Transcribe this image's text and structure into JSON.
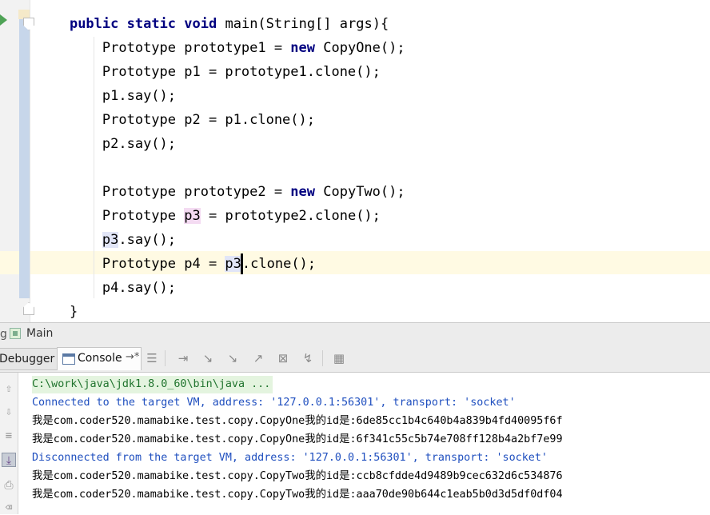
{
  "editor": {
    "lines": [
      {
        "indent": "    ",
        "tokens": [
          {
            "t": "public",
            "k": "kw"
          },
          {
            "t": " "
          },
          {
            "t": "static",
            "k": "kw"
          },
          {
            "t": " "
          },
          {
            "t": "void",
            "k": "kw"
          },
          {
            "t": " main(String[] args){"
          }
        ]
      },
      {
        "indent": "        ",
        "tokens": [
          {
            "t": "Prototype prototype1 = "
          },
          {
            "t": "new",
            "k": "kw"
          },
          {
            "t": " CopyOne();"
          }
        ]
      },
      {
        "indent": "        ",
        "tokens": [
          {
            "t": "Prototype p1 = prototype1.clone();"
          }
        ]
      },
      {
        "indent": "        ",
        "tokens": [
          {
            "t": "p1.say();"
          }
        ]
      },
      {
        "indent": "        ",
        "tokens": [
          {
            "t": "Prototype p2 = p1.clone();"
          }
        ]
      },
      {
        "indent": "        ",
        "tokens": [
          {
            "t": "p2.say();"
          }
        ]
      },
      {
        "indent": "",
        "tokens": []
      },
      {
        "indent": "        ",
        "tokens": [
          {
            "t": "Prototype prototype2 = "
          },
          {
            "t": "new",
            "k": "kw"
          },
          {
            "t": " CopyTwo();"
          }
        ]
      },
      {
        "indent": "        ",
        "tokens": [
          {
            "t": "Prototype "
          },
          {
            "t": "p3",
            "k": "hl-write"
          },
          {
            "t": " = prototype2.clone();"
          }
        ]
      },
      {
        "indent": "        ",
        "tokens": [
          {
            "t": "p3",
            "k": "hl-read"
          },
          {
            "t": ".say();"
          }
        ]
      },
      {
        "indent": "        ",
        "tokens": [
          {
            "t": "Prototype p4 = "
          },
          {
            "t": "p3",
            "k": "hl-read"
          },
          {
            "t": "",
            "k": "caret"
          },
          {
            "t": ".clone();"
          }
        ]
      },
      {
        "indent": "        ",
        "tokens": [
          {
            "t": "p4.say();"
          }
        ]
      },
      {
        "indent": "    ",
        "tokens": [
          {
            "t": "}"
          }
        ]
      }
    ]
  },
  "run_panel": {
    "gutter_char": "g",
    "config_name": "Main",
    "tabs": {
      "debugger": "Debugger",
      "console": "Console",
      "console_pin": "→*"
    }
  },
  "console": {
    "lines": [
      {
        "text": "C:\\work\\java\\jdk1.8.0_60\\bin\\java ...",
        "kind": "cmd"
      },
      {
        "text": "Connected to the target VM, address: '127.0.0.1:56301', transport: 'socket'",
        "kind": "sys"
      },
      {
        "text": "我是com.coder520.mamabike.test.copy.CopyOne我的id是:6de85cc1b4c640b4a839b4fd40095f6f",
        "kind": "out"
      },
      {
        "text": "我是com.coder520.mamabike.test.copy.CopyOne我的id是:6f341c55c5b74e708ff128b4a2bf7e99",
        "kind": "out"
      },
      {
        "text": "Disconnected from the target VM, address: '127.0.0.1:56301', transport: 'socket'",
        "kind": "sys"
      },
      {
        "text": "我是com.coder520.mamabike.test.copy.CopyTwo我的id是:ccb8cfdde4d9489b9cec632d6c534876",
        "kind": "out"
      },
      {
        "text": "我是com.coder520.mamabike.test.copy.CopyTwo我的id是:aaa70de90b644c1eab5b0d3d5df0df04",
        "kind": "out"
      }
    ]
  },
  "colors": {
    "keyword": "#000080",
    "console_system": "#1f4fbf",
    "console_command": "#20742e",
    "caret_row": "#fffae3"
  }
}
